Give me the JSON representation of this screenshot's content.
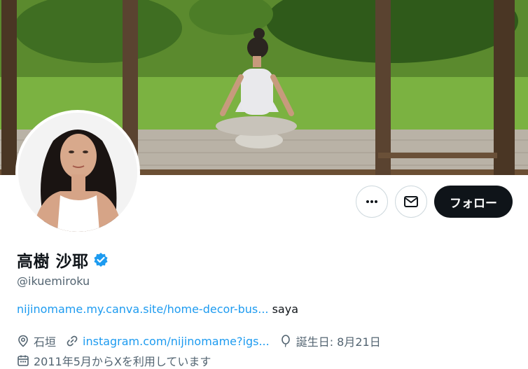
{
  "profile": {
    "display_name": "高樹 沙耶",
    "handle": "@ikuemiroku",
    "verified": true,
    "follow_label": "フォロー",
    "bio_link": "nijinomame.my.canva.site/home-decor-bus...",
    "bio_text": "saya",
    "location": "石垣",
    "website": "instagram.com/nijinomame?igs...",
    "birthday": "誕生日: 8月21日",
    "joined": "2011年5月からXを利用しています"
  },
  "icons": {
    "more": "more-horizontal-icon",
    "message": "envelope-icon",
    "verified": "verified-badge-icon",
    "location": "location-pin-icon",
    "website": "link-icon",
    "birthday": "balloon-icon",
    "joined": "calendar-icon"
  },
  "colors": {
    "accent": "#1d9bf0",
    "text": "#0f1419",
    "secondary": "#536471",
    "follow_bg": "#0f1419"
  }
}
